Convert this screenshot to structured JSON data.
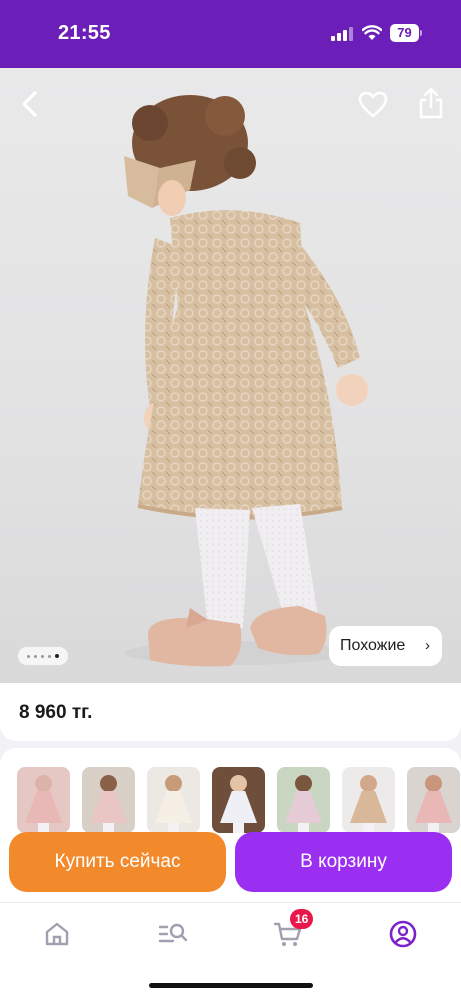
{
  "status_bar": {
    "time": "21:55",
    "battery": "79",
    "icons": [
      "signal-icon",
      "wifi-icon",
      "battery-icon"
    ]
  },
  "product": {
    "image_pager": {
      "pages": 5,
      "active": 4
    },
    "similar_label": "Похожие",
    "similar_chevron": "›",
    "price": "8 960 тг.",
    "thumbnails_count": 8
  },
  "actions": {
    "buy_now": "Купить сейчас",
    "add_to_cart": "В корзину"
  },
  "bottom_nav": {
    "tabs": [
      "home-icon",
      "catalog-search-icon",
      "cart-icon",
      "profile-icon"
    ],
    "active_tab": "profile-icon",
    "cart_badge": "16"
  },
  "colors": {
    "brand_purple": "#6b1fb8",
    "buy_orange": "#f28a2c",
    "cart_purple": "#9b2ff1",
    "badge_red": "#e8194a",
    "active_nav": "#7b22c9"
  }
}
